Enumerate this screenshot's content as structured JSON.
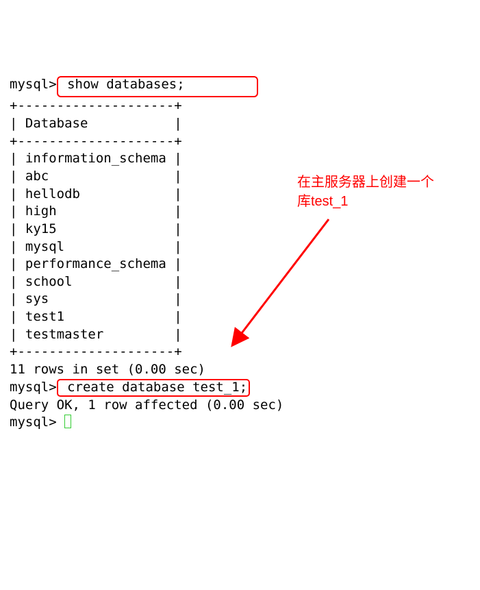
{
  "terminal": {
    "prompt1": "mysql>",
    "cmd1": " show databases;         ",
    "border_top": "+--------------------+",
    "header_row": "| Database           |",
    "border_mid": "+--------------------+",
    "rows": [
      "| information_schema |",
      "| abc                |",
      "| hellodb            |",
      "| high               |",
      "| ky15               |",
      "| mysql              |",
      "| performance_schema |",
      "| school             |",
      "| sys                |",
      "| test1              |",
      "| testmaster         |"
    ],
    "border_bot": "+--------------------+",
    "result1": "11 rows in set (0.00 sec)",
    "blank": "",
    "prompt2": "mysql>",
    "cmd2": " create database test_1;",
    "result2": "Query OK, 1 row affected (0.00 sec)",
    "prompt3": "mysql> "
  },
  "annotation": {
    "line1": "在主服务器上创建一个",
    "line2": "库test_1"
  },
  "colors": {
    "highlight": "#ff0000",
    "cursor": "#33cc33"
  }
}
